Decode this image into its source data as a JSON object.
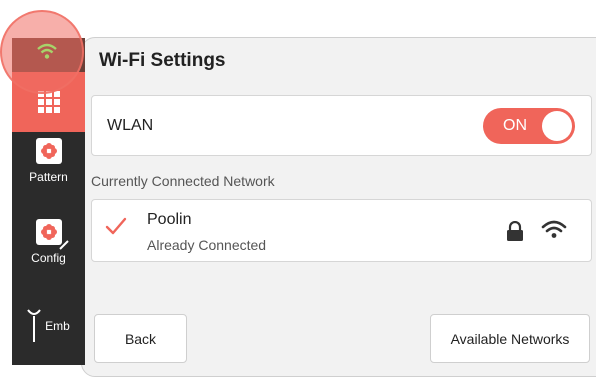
{
  "header": {
    "title": "Wi-Fi Settings"
  },
  "sidebar": {
    "items": [
      {
        "label": "Pattern",
        "icon": "flower-doc-icon"
      },
      {
        "label": "Config",
        "icon": "flower-doc-edit-icon"
      },
      {
        "label": "Emb",
        "icon": "needle-icon"
      }
    ]
  },
  "wlan": {
    "label": "WLAN",
    "toggle_text": "ON",
    "enabled": true
  },
  "connected": {
    "section_label": "Currently Connected Network",
    "name": "Poolin",
    "status": "Already Connected"
  },
  "buttons": {
    "back": "Back",
    "available": "Available Networks"
  },
  "colors": {
    "accent": "#f0655a",
    "rail": "#2b2b2b",
    "panel": "#f2f2f2"
  }
}
